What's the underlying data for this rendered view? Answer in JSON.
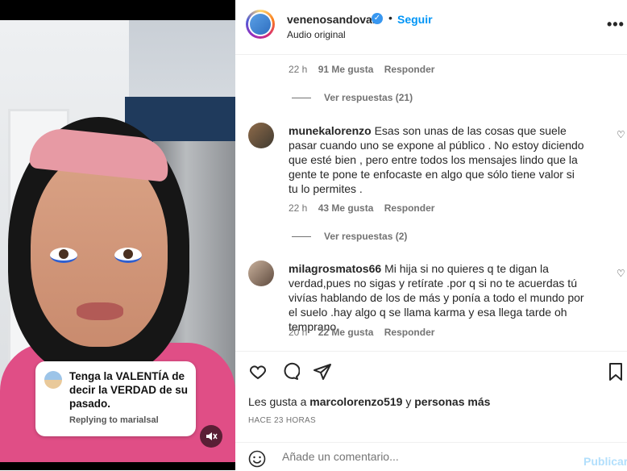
{
  "media": {
    "reply_card": {
      "text": "Tenga la VALENTÍA de decir la VERDAD de su pasado.",
      "meta": "Replying to marialsal"
    },
    "mute_icon": "muted-speaker-icon"
  },
  "header": {
    "username": "venenosandoval",
    "dot": "•",
    "follow_label": "Seguir",
    "subtitle": "Audio original",
    "more_icon": "•••"
  },
  "comments": {
    "top_meta": {
      "time": "22 h",
      "likes": "91 Me gusta",
      "reply": "Responder"
    },
    "top_view_replies": "Ver respuestas (21)",
    "items": [
      {
        "username": "munekalorenzo",
        "text": "Esas son unas de las cosas que suele pasar cuando uno se expone al público . No estoy diciendo que esté bien , pero entre todos los mensajes lindo que la gente te pone te enfocaste en algo que sólo tiene valor si tu lo permites .",
        "time": "22 h",
        "likes": "43 Me gusta",
        "reply": "Responder",
        "view_replies": "Ver respuestas (2)"
      },
      {
        "username": "milagrosmatos66",
        "text": "Mi hija si no quieres q te digan la verdad,pues no sigas y retírate .por q si no te acuerdas tú vivías hablando de los de más y ponía a todo el mundo por el suelo .hay algo q se llama karma y esa llega tarde oh temprano.",
        "time": "20 h",
        "likes": "22 Me gusta",
        "reply": "Responder"
      }
    ]
  },
  "actions": {
    "like_icon": "heart-icon",
    "comment_icon": "comment-bubble-icon",
    "share_icon": "paper-plane-icon",
    "save_icon": "bookmark-icon"
  },
  "likes": {
    "prefix": "Les gusta a",
    "user": "marcolorenzo519",
    "middle": "y",
    "others": "personas más"
  },
  "timestamp": "HACE 23 HORAS",
  "comment_bar": {
    "emoji_icon": "smiley-icon",
    "placeholder": "Añade un comentario...",
    "publish_label": "Publicar"
  }
}
